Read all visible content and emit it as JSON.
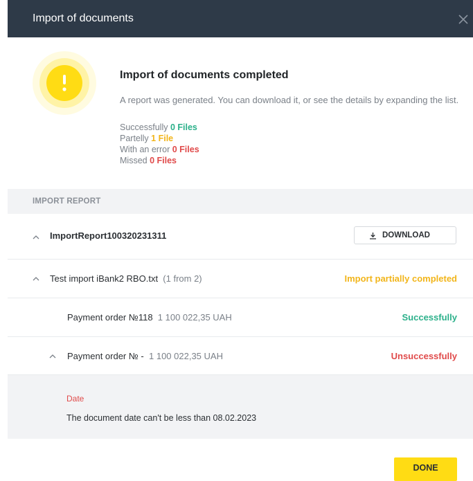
{
  "dialog": {
    "title": "Import of documents"
  },
  "summary": {
    "title": "Import of documents completed",
    "subtitle": "A report was generated. You can download it, or see the details by expanding the list.",
    "stats": [
      {
        "label": "Successfully",
        "value": "0 Files",
        "color": "#2bb08a"
      },
      {
        "label": "Partelly",
        "value": "1 File",
        "color": "#f2b51a"
      },
      {
        "label": "With an error",
        "value": "0 Files",
        "color": "#e04a4a"
      },
      {
        "label": "Missed",
        "value": "0 Files",
        "color": "#e04a4a"
      }
    ]
  },
  "report": {
    "section_label": "IMPORT REPORT",
    "name": "ImportReport100320231311",
    "download_label": "DOWNLOAD",
    "file": {
      "name": "Test import iBank2 RBO.txt",
      "count": "(1 from 2)",
      "status": "Import partially completed"
    },
    "orders": [
      {
        "label": "Payment order №118",
        "amount": "1 100 022,35 UAH",
        "status": "Successfully"
      },
      {
        "label": "Payment order № -",
        "amount": "1 100 022,35 UAH",
        "status": "Unsuccessfully"
      }
    ],
    "error": {
      "field": "Date",
      "message": "The document date can't be less than 08.02.2023"
    }
  },
  "footer": {
    "done_label": "DONE"
  },
  "colors": {
    "header": "#2e3a48",
    "accent": "#ffdc14",
    "success": "#2bb08a",
    "partial": "#f2b51a",
    "error": "#e04a4a"
  }
}
